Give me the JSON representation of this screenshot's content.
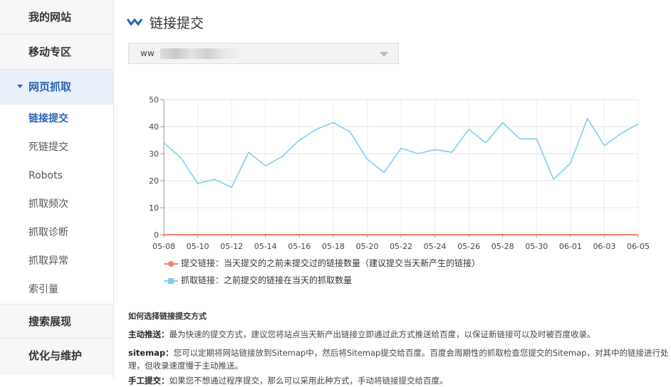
{
  "sidebar": {
    "top_sections": [
      "我的网站",
      "移动专区"
    ],
    "active_section": "网页抓取",
    "sub_items": [
      {
        "label": "链接提交",
        "current": true
      },
      {
        "label": "死链提交",
        "current": false
      },
      {
        "label": "Robots",
        "current": false
      },
      {
        "label": "抓取频次",
        "current": false
      },
      {
        "label": "抓取诊断",
        "current": false
      },
      {
        "label": "抓取异常",
        "current": false
      },
      {
        "label": "索引量",
        "current": false
      }
    ],
    "bottom_sections": [
      "搜索展现",
      "优化与维护"
    ]
  },
  "page": {
    "title": "链接提交",
    "title_icon": "chart-icon",
    "site_select_value": "ww",
    "site_select_masked": true
  },
  "chart_data": {
    "type": "line",
    "x": [
      "05-08",
      "05-09",
      "05-10",
      "05-11",
      "05-12",
      "05-13",
      "05-14",
      "05-15",
      "05-16",
      "05-17",
      "05-18",
      "05-19",
      "05-20",
      "05-21",
      "05-22",
      "05-23",
      "05-24",
      "05-25",
      "05-26",
      "05-27",
      "05-28",
      "05-29",
      "05-30",
      "05-31",
      "06-01",
      "06-02",
      "06-03",
      "06-04",
      "06-05"
    ],
    "x_tick_labels": [
      "05-08",
      "05-10",
      "05-12",
      "05-14",
      "05-16",
      "05-18",
      "05-20",
      "05-22",
      "05-24",
      "05-26",
      "05-28",
      "05-30",
      "06-01",
      "06-03",
      "06-05"
    ],
    "ylim": [
      0,
      50
    ],
    "y_ticks": [
      0,
      10,
      20,
      30,
      40,
      50
    ],
    "grid": true,
    "series": [
      {
        "name": "提交链接：当天提交的之前未提交过的链接数量（建议提交当天新产生的链接）",
        "color": "#f47f6b",
        "values": [
          0,
          0,
          0,
          0,
          0,
          0,
          0,
          0,
          0,
          0,
          0,
          0,
          0,
          0,
          0,
          0,
          0,
          0,
          0,
          0,
          0,
          0,
          0,
          0,
          0,
          0,
          0,
          0,
          0
        ]
      },
      {
        "name": "抓取链接：之前提交的链接在当天的抓取数量",
        "color": "#7dcfef",
        "values": [
          34,
          28.5,
          19,
          20.5,
          17.5,
          30.5,
          25.5,
          29,
          35,
          39,
          41.5,
          38,
          28,
          23,
          32,
          30,
          31.5,
          30.5,
          39,
          34,
          41.5,
          35.5,
          35.5,
          20.5,
          26.5,
          43,
          33,
          37.5,
          41
        ]
      }
    ],
    "legend_position": "bottom-left"
  },
  "help": {
    "heading": "如何选择链接提交方式",
    "items": [
      {
        "label": "主动推送：",
        "text": "最为快速的提交方式，建议您将站点当天新产出链接立即通过此方式推送给百度，以保证新链接可以及时被百度收录。"
      },
      {
        "label": "sitemap：",
        "text": "您可以定期将网站链接放到Sitemap中，然后将Sitemap提交给百度。百度会周期性的抓取检查您提交的Sitemap，对其中的链接进行处理，但收录速度慢于主动推送。"
      },
      {
        "label": "手工提交：",
        "text": "如果您不想通过程序提交，那么可以采用此种方式，手动将链接提交给百度。"
      }
    ]
  }
}
